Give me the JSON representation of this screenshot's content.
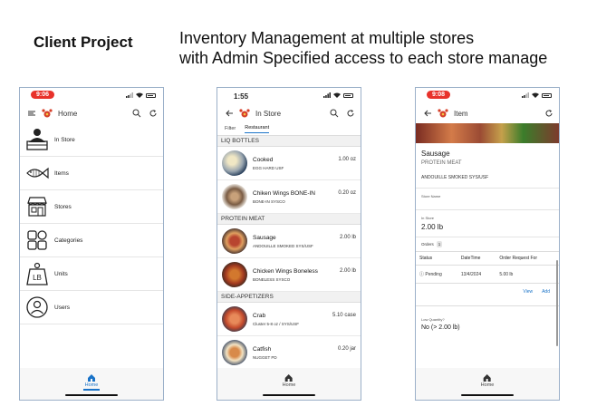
{
  "headings": {
    "left": "Client Project",
    "right_line1": "Inventory Management at multiple stores",
    "right_line2": "with Admin Specified access to each store manage"
  },
  "phone1": {
    "time": "9:06",
    "title": "Home",
    "menu": [
      {
        "label": "In Store",
        "icon": "store-person-icon"
      },
      {
        "label": "Items",
        "icon": "fish-icon"
      },
      {
        "label": "Stores",
        "icon": "storefront-icon"
      },
      {
        "label": "Categories",
        "icon": "categories-icon"
      },
      {
        "label": "Units",
        "icon": "weight-lb-icon"
      },
      {
        "label": "Users",
        "icon": "user-icon"
      }
    ],
    "nav_home": "Home"
  },
  "phone2": {
    "time": "1:55",
    "title": "In Store",
    "tabs": [
      "Filter",
      "Restaurant"
    ],
    "sections": [
      {
        "header": "LIQ BOTTLES",
        "rows": [
          {
            "name": "Cooked",
            "sub": "EGG HARD USF",
            "qty": "1.00 oz"
          },
          {
            "name": "Chiken Wings BONE-IN",
            "sub": "BONE-IN SYSCO",
            "qty": "0.20 oz"
          }
        ]
      },
      {
        "header": "PROTEIN MEAT",
        "rows": [
          {
            "name": "Sausage",
            "sub": "ANDOUILLE SMOKED SYS/USF",
            "qty": "2.00 lb"
          },
          {
            "name": "Chicken Wings Boneless",
            "sub": "BONELESS SYSCO",
            "qty": "2.00 lb"
          }
        ]
      },
      {
        "header": "SIDE-APPETIZERS",
        "rows": [
          {
            "name": "Crab",
            "sub": "Cluster 5-8 oz / SYS/USF",
            "qty": "5.10 case"
          },
          {
            "name": "Catfish",
            "sub": "NUGGET PD",
            "qty": "0.20 jar"
          }
        ]
      }
    ],
    "nav_home": "Home"
  },
  "phone3": {
    "time": "9:08",
    "title": "Item",
    "item_name": "Sausage",
    "item_category": "PROTEIN MEAT",
    "item_desc": "ANDOUILLE SMOKED SYS/USF",
    "store_name_label": "Store Name",
    "in_store_label": "In Store",
    "in_store_value": "2.00 lb",
    "orders_label": "Orders",
    "orders_count": "1",
    "table_headers": [
      "Status",
      "DateTime",
      "Order Request For"
    ],
    "order": {
      "status": "Pending",
      "date": "13/4/2024",
      "amount": "5.00 lb"
    },
    "view_label": "View",
    "add_label": "Add",
    "low_qty_label": "Low Quantity?",
    "low_qty_value": "No (> 2.00 lb)",
    "nav_home": "Home"
  },
  "colors": {
    "accent": "#1a73c8",
    "time_pill": "#e8322b",
    "pending": "#c9a30a"
  }
}
